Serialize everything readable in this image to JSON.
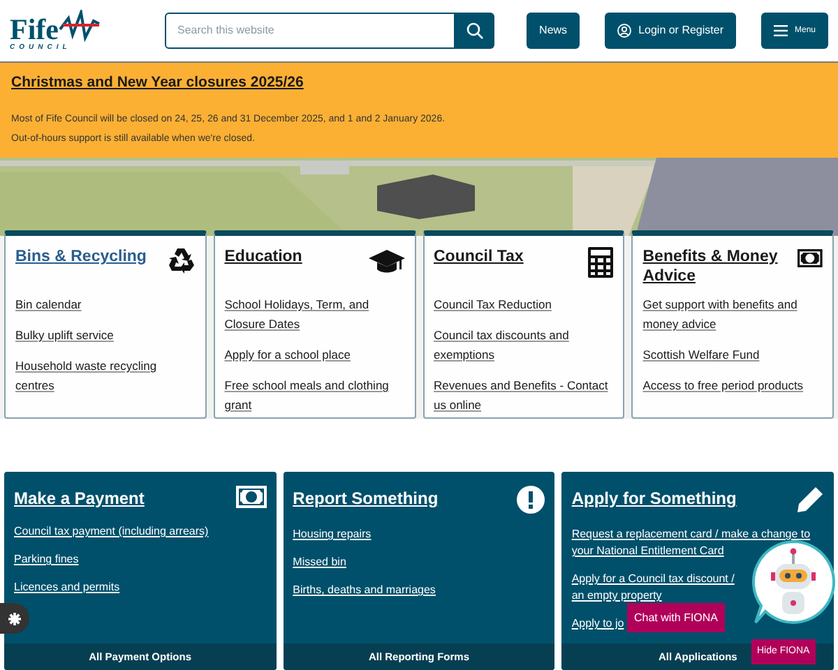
{
  "header": {
    "logo": {
      "name": "Fife",
      "sub": "COUNCIL"
    },
    "search": {
      "placeholder": "Search this website"
    },
    "buttons": [
      {
        "kind": "plain",
        "label": "News"
      },
      {
        "kind": "user",
        "label": "Login or Register"
      },
      {
        "kind": "menu",
        "label": "Menu"
      }
    ]
  },
  "alert": {
    "title": "Christmas and New Year closures 2025/26",
    "lines": [
      "Most of Fife Council will be closed on 24, 25, 26 and 31 December 2025, and 1 and 2 January 2026.",
      "Out-of-hours support is still available when we're closed."
    ]
  },
  "topics": [
    {
      "title": "Bins & Recycling",
      "visited": true,
      "links": [
        "Bin calendar",
        "Bulky uplift service",
        "Household waste recycling centres"
      ]
    },
    {
      "title": "Education",
      "visited": false,
      "links": [
        "School Holidays, Term, and Closure Dates",
        "Apply for a school place",
        "Free school meals and clothing grant"
      ]
    },
    {
      "title": "Council Tax",
      "visited": false,
      "links": [
        "Council Tax Reduction",
        "Council tax discounts and exemptions",
        "Revenues and Benefits - Contact us online"
      ]
    },
    {
      "title": "Benefits & Money Advice",
      "visited": false,
      "links": [
        "Get support with benefits and money advice",
        "Scottish Welfare Fund",
        "Access to free period products"
      ]
    }
  ],
  "actions": [
    {
      "title": "Make a Payment",
      "links": [
        "Council tax payment (including arrears)",
        "Parking fines",
        "Licences and permits"
      ],
      "footer": "All Payment Options"
    },
    {
      "title": "Report Something",
      "links": [
        "Housing repairs",
        "Missed bin",
        "Births, deaths and marriages"
      ],
      "footer": "All Reporting Forms"
    },
    {
      "title": "Apply for Something",
      "links": [
        "Request a replacement card / make a change to your National Entitlement Card",
        "Apply for a Council tax discount / an empty property",
        "Apply to jo"
      ],
      "footer": "All Applications"
    }
  ],
  "chat": {
    "open_label": "Chat with FIONA",
    "hide_label": "Hide FIONA"
  }
}
